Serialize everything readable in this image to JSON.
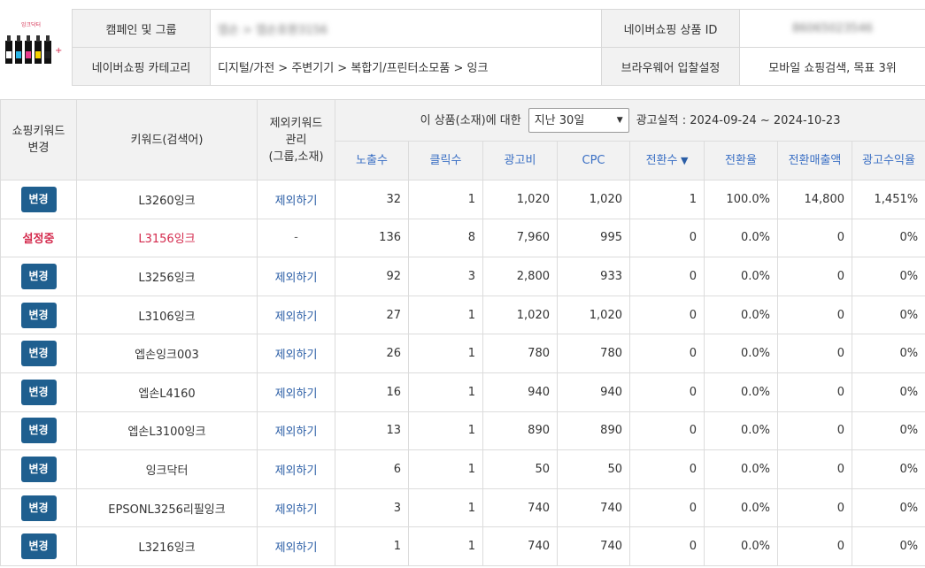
{
  "product": {
    "thumbnail_caption": "잉크닥터",
    "campaign_label": "캠페인 및 그룹",
    "campaign_value": "엡손 > 엡손호환3156",
    "naver_id_label": "네이버쇼핑 상품 ID",
    "naver_id_value": "86065023546",
    "category_label": "네이버쇼핑 카테고리",
    "category_value": "디지털/가전 > 주변기기 > 복합기/프린터소모품 > 잉크",
    "bidding_label": "브라우웨어 입찰설정",
    "bidding_value": "모바일 쇼핑검색, 목표 3위"
  },
  "table": {
    "col_change": "쇼핑키워드\n변경",
    "col_keyword": "키워드(검색어)",
    "col_exclude": "제외키워드\n관리\n(그룹,소재)",
    "period_prefix": "이 상품(소재)에 대한",
    "period_selected": "지난 30일",
    "period_suffix": "광고실적 : 2024-09-24 ~ 2024-10-23",
    "metrics": [
      "노출수",
      "클릭수",
      "광고비",
      "CPC",
      "전환수",
      "전환율",
      "전환매출액",
      "광고수익율"
    ],
    "sort_indicator": "▼",
    "change_btn_label": "변경",
    "setting_label": "설정중",
    "exclude_label": "제외하기",
    "dash": "-",
    "rows": [
      {
        "status": "change",
        "keyword": "L3260잉크",
        "exclude": true,
        "impressions": "32",
        "clicks": "1",
        "cost": "1,020",
        "cpc": "1,020",
        "conversions": "1",
        "conv_rate": "100.0%",
        "conv_sales": "14,800",
        "roas": "1,451%"
      },
      {
        "status": "setting",
        "keyword": "L3156잉크",
        "exclude": false,
        "impressions": "136",
        "clicks": "8",
        "cost": "7,960",
        "cpc": "995",
        "conversions": "0",
        "conv_rate": "0.0%",
        "conv_sales": "0",
        "roas": "0%"
      },
      {
        "status": "change",
        "keyword": "L3256잉크",
        "exclude": true,
        "impressions": "92",
        "clicks": "3",
        "cost": "2,800",
        "cpc": "933",
        "conversions": "0",
        "conv_rate": "0.0%",
        "conv_sales": "0",
        "roas": "0%"
      },
      {
        "status": "change",
        "keyword": "L3106잉크",
        "exclude": true,
        "impressions": "27",
        "clicks": "1",
        "cost": "1,020",
        "cpc": "1,020",
        "conversions": "0",
        "conv_rate": "0.0%",
        "conv_sales": "0",
        "roas": "0%"
      },
      {
        "status": "change",
        "keyword": "엡손잉크003",
        "exclude": true,
        "impressions": "26",
        "clicks": "1",
        "cost": "780",
        "cpc": "780",
        "conversions": "0",
        "conv_rate": "0.0%",
        "conv_sales": "0",
        "roas": "0%"
      },
      {
        "status": "change",
        "keyword": "엡손L4160",
        "exclude": true,
        "impressions": "16",
        "clicks": "1",
        "cost": "940",
        "cpc": "940",
        "conversions": "0",
        "conv_rate": "0.0%",
        "conv_sales": "0",
        "roas": "0%"
      },
      {
        "status": "change",
        "keyword": "엡손L3100잉크",
        "exclude": true,
        "impressions": "13",
        "clicks": "1",
        "cost": "890",
        "cpc": "890",
        "conversions": "0",
        "conv_rate": "0.0%",
        "conv_sales": "0",
        "roas": "0%"
      },
      {
        "status": "change",
        "keyword": "잉크닥터",
        "exclude": true,
        "impressions": "6",
        "clicks": "1",
        "cost": "50",
        "cpc": "50",
        "conversions": "0",
        "conv_rate": "0.0%",
        "conv_sales": "0",
        "roas": "0%"
      },
      {
        "status": "change",
        "keyword": "EPSONL3256리필잉크",
        "exclude": true,
        "impressions": "3",
        "clicks": "1",
        "cost": "740",
        "cpc": "740",
        "conversions": "0",
        "conv_rate": "0.0%",
        "conv_sales": "0",
        "roas": "0%"
      },
      {
        "status": "change",
        "keyword": "L3216잉크",
        "exclude": true,
        "impressions": "1",
        "clicks": "1",
        "cost": "740",
        "cpc": "740",
        "conversions": "0",
        "conv_rate": "0.0%",
        "conv_sales": "0",
        "roas": "0%"
      }
    ]
  },
  "colors": {
    "button_bg": "#1f5f8f",
    "active_red": "#d42a4d",
    "link_blue": "#2b5ea6",
    "header_bg": "#f2f2f2"
  }
}
